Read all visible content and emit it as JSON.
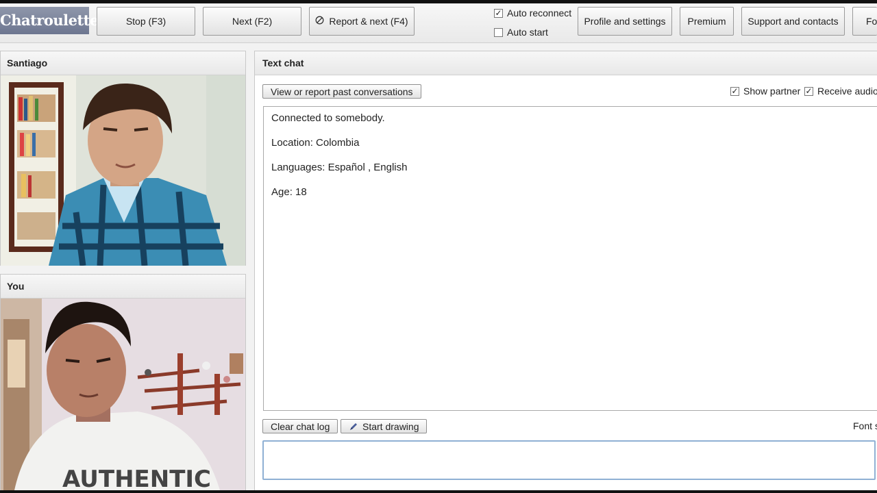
{
  "toolbar": {
    "logo": "Chatroulette",
    "stop_label": "Stop (F3)",
    "next_label": "Next (F2)",
    "report_label": "Report & next (F4)",
    "auto_reconnect_label": "Auto reconnect",
    "auto_reconnect_checked": true,
    "auto_start_label": "Auto start",
    "auto_start_checked": false,
    "profile_label": "Profile and settings",
    "premium_label": "Premium",
    "support_label": "Support and contacts",
    "cutoff_label": "Fo"
  },
  "partner_panel": {
    "name": "Santiago"
  },
  "self_panel": {
    "name": "You"
  },
  "chat": {
    "title": "Text chat",
    "view_report_label": "View or report past conversations",
    "show_partner_label": "Show partner",
    "show_partner_checked": true,
    "receive_audio_label": "Receive audio",
    "receive_audio_checked": true,
    "messages": [
      "Connected to somebody.",
      "Location: Colombia",
      "Languages: Español , English",
      "Age: 18"
    ],
    "clear_label": "Clear chat log",
    "draw_label": "Start drawing",
    "font_size_label": "Font s",
    "input_value": ""
  }
}
